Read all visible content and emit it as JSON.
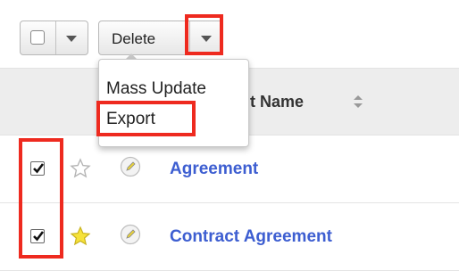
{
  "toolbar": {
    "delete_label": "Delete"
  },
  "dropdown_menu": {
    "items": [
      {
        "label": "Mass Update"
      },
      {
        "label": "Export"
      }
    ]
  },
  "list_header": {
    "name_column": "Agreement Name"
  },
  "rows": [
    {
      "name": "Agreement",
      "checked": true,
      "favorite": false
    },
    {
      "name": "Contract Agreement",
      "checked": true,
      "favorite": true
    }
  ],
  "colors": {
    "highlight": "#ee2a1f",
    "link": "#3d5ed1",
    "favorite_star": "#f6e23a"
  }
}
